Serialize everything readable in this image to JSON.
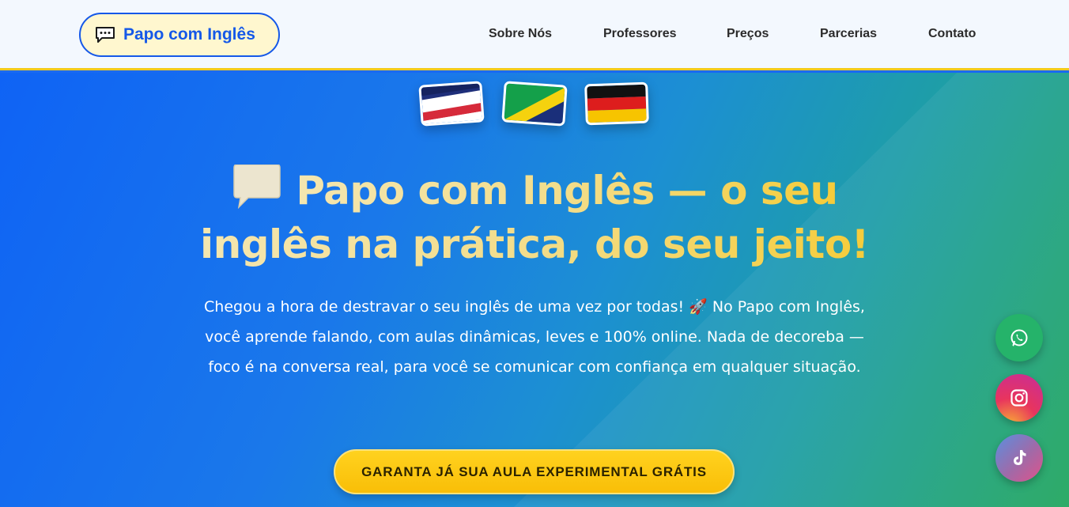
{
  "header": {
    "logo_text": "Papo com Inglês",
    "logo_icon": "speech-bubble-icon",
    "nav": [
      "Sobre Nós",
      "Professores",
      "Preços",
      "Parcerias",
      "Contato"
    ]
  },
  "hero": {
    "flags": [
      "united-states-flag-icon",
      "brazil-flag-icon",
      "germany-flag-icon"
    ],
    "headline_line1": "Papo com Inglês — o seu",
    "headline_line2": "inglês na prática, do seu jeito!",
    "subtitle": "Chegou a hora de destravar o seu inglês de uma vez por todas! 🚀 No Papo com Inglês, você aprende falando, com aulas dinâmicas, leves e 100% online. Nada de decoreba — foco é na conversa real, para você se comunicar com confiança em qualquer situação.",
    "cta_label": "GARANTA JÁ SUA AULA EXPERIMENTAL GRÁTIS"
  },
  "socials": [
    {
      "name": "whatsapp-icon",
      "color": "#25b36a"
    },
    {
      "name": "instagram-icon",
      "color": "#e0307a"
    },
    {
      "name": "tiktok-icon",
      "color": "#9a6aa8"
    }
  ],
  "colors": {
    "brand_blue": "#1558e8",
    "accent_yellow": "#f9c60b",
    "header_border": "#f2cb1d"
  }
}
